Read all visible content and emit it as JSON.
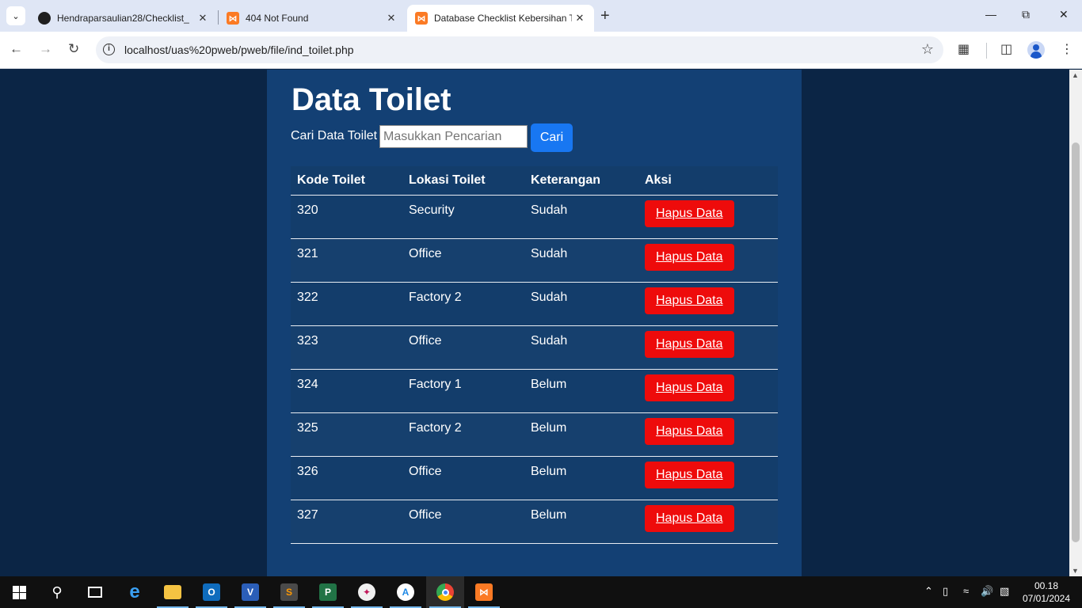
{
  "browser": {
    "tabs": [
      {
        "title": "Hendraparsaulian28/Checklist_",
        "icon": "github-icon"
      },
      {
        "title": "404 Not Found",
        "icon": "xampp-icon"
      },
      {
        "title": "Database Checklist Kebersihan T",
        "icon": "xampp-icon"
      }
    ],
    "url": "localhost/uas%20pweb/pweb/file/ind_toilet.php"
  },
  "page": {
    "title": "Data Toilet",
    "search": {
      "label": "Cari Data Toilet",
      "placeholder": "Masukkan Pencarian",
      "button": "Cari"
    },
    "table": {
      "headers": [
        "Kode Toilet",
        "Lokasi Toilet",
        "Keterangan",
        "Aksi"
      ],
      "action_label": "Hapus Data",
      "rows": [
        {
          "kode": "320",
          "lokasi": "Security",
          "keterangan": "Sudah"
        },
        {
          "kode": "321",
          "lokasi": "Office",
          "keterangan": "Sudah"
        },
        {
          "kode": "322",
          "lokasi": "Factory 2",
          "keterangan": "Sudah"
        },
        {
          "kode": "323",
          "lokasi": "Office",
          "keterangan": "Sudah"
        },
        {
          "kode": "324",
          "lokasi": "Factory 1",
          "keterangan": "Belum"
        },
        {
          "kode": "325",
          "lokasi": "Factory 2",
          "keterangan": "Belum"
        },
        {
          "kode": "326",
          "lokasi": "Office",
          "keterangan": "Belum"
        },
        {
          "kode": "327",
          "lokasi": "Office",
          "keterangan": "Belum"
        }
      ]
    }
  },
  "taskbar": {
    "time": "00.18",
    "date": "07/01/2024"
  },
  "colors": {
    "page_background": "#0b2545",
    "content_background": "#134074",
    "search_button": "#1877f2",
    "delete_button": "#ee0b0b"
  }
}
